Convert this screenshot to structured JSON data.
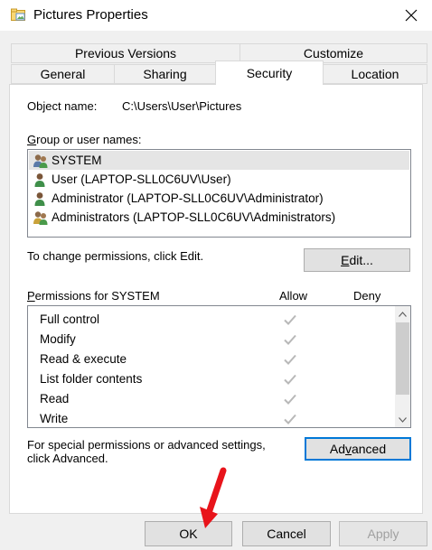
{
  "window": {
    "title": "Pictures Properties"
  },
  "tabs": {
    "row1": [
      "Previous Versions",
      "Customize"
    ],
    "row2": [
      "General",
      "Sharing",
      "Security",
      "Location"
    ],
    "active": "Security"
  },
  "object": {
    "label": "Object name:",
    "value": "C:\\Users\\User\\Pictures"
  },
  "groups": {
    "label_prefix": "G",
    "label_rest": "roup or user names:",
    "items": [
      "SYSTEM",
      "User (LAPTOP-SLL0C6UV\\User)",
      "Administrator (LAPTOP-SLL0C6UV\\Administrator)",
      "Administrators (LAPTOP-SLL0C6UV\\Administrators)"
    ]
  },
  "change": {
    "text": "To change permissions, click Edit.",
    "edit_prefix": "E",
    "edit_rest": "dit..."
  },
  "permissions": {
    "label_prefix": "P",
    "label_rest": "ermissions for SYSTEM",
    "allow_header": "Allow",
    "deny_header": "Deny",
    "rows": [
      "Full control",
      "Modify",
      "Read & execute",
      "List folder contents",
      "Read",
      "Write"
    ]
  },
  "special": {
    "text1": "For special permissions or advanced settings,",
    "text2": "click Advanced.",
    "adv_prefix": "Ad",
    "adv_u": "v",
    "adv_rest": "anced"
  },
  "footer": {
    "ok": "OK",
    "cancel": "Cancel",
    "apply": "Apply"
  },
  "colors": {
    "accent": "#0078d7",
    "annotation_arrow": "#e8141b"
  },
  "icons": {
    "window": "folder-pictures-icon",
    "close": "close-icon",
    "system": "group-users-icon",
    "user": "user-icon",
    "check": "checkmark-icon"
  }
}
